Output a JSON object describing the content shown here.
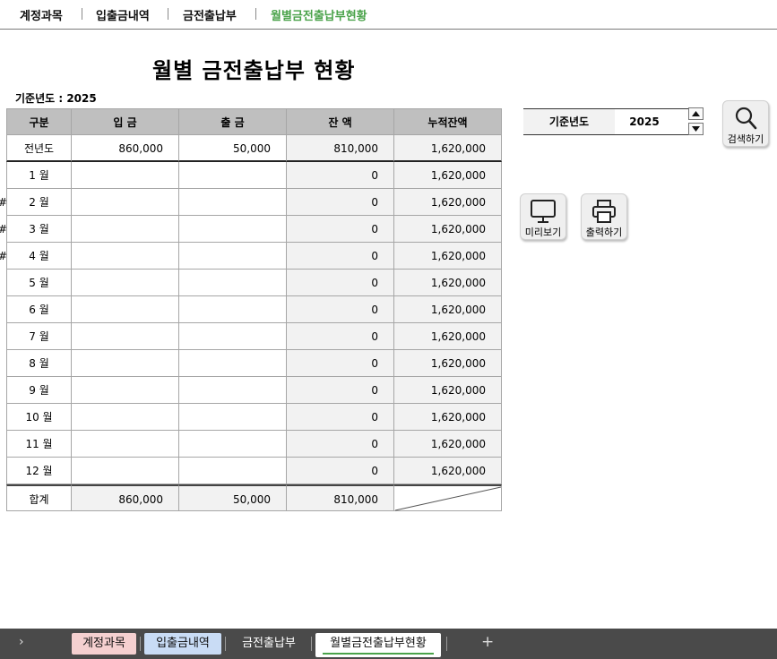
{
  "topnav": {
    "items": [
      {
        "label": "계정과목"
      },
      {
        "label": "입출금내역"
      },
      {
        "label": "금전출납부"
      },
      {
        "label": "월별금전출납부현황"
      }
    ],
    "active_color": "#4aa34a"
  },
  "page": {
    "title": "월별 금전출납부 현황",
    "year_caption": "기준년도 : 2025"
  },
  "table": {
    "headers": [
      "구분",
      "입 금",
      "출 금",
      "잔 액",
      "누적잔액"
    ],
    "prev_year": {
      "label": "전년도",
      "deposit": "860,000",
      "withdraw": "50,000",
      "balance": "810,000",
      "cumulative": "1,620,000"
    },
    "months": [
      {
        "label": "1 월",
        "deposit": "",
        "withdraw": "",
        "balance": "0",
        "cumulative": "1,620,000",
        "mark": ""
      },
      {
        "label": "2 월",
        "deposit": "",
        "withdraw": "",
        "balance": "0",
        "cumulative": "1,620,000",
        "mark": "#"
      },
      {
        "label": "3 월",
        "deposit": "",
        "withdraw": "",
        "balance": "0",
        "cumulative": "1,620,000",
        "mark": "#"
      },
      {
        "label": "4 월",
        "deposit": "",
        "withdraw": "",
        "balance": "0",
        "cumulative": "1,620,000",
        "mark": "#"
      },
      {
        "label": "5 월",
        "deposit": "",
        "withdraw": "",
        "balance": "0",
        "cumulative": "1,620,000",
        "mark": ""
      },
      {
        "label": "6 월",
        "deposit": "",
        "withdraw": "",
        "balance": "0",
        "cumulative": "1,620,000",
        "mark": ""
      },
      {
        "label": "7 월",
        "deposit": "",
        "withdraw": "",
        "balance": "0",
        "cumulative": "1,620,000",
        "mark": ""
      },
      {
        "label": "8 월",
        "deposit": "",
        "withdraw": "",
        "balance": "0",
        "cumulative": "1,620,000",
        "mark": ""
      },
      {
        "label": "9 월",
        "deposit": "",
        "withdraw": "",
        "balance": "0",
        "cumulative": "1,620,000",
        "mark": ""
      },
      {
        "label": "10 월",
        "deposit": "",
        "withdraw": "",
        "balance": "0",
        "cumulative": "1,620,000",
        "mark": ""
      },
      {
        "label": "11 월",
        "deposit": "",
        "withdraw": "",
        "balance": "0",
        "cumulative": "1,620,000",
        "mark": ""
      },
      {
        "label": "12 월",
        "deposit": "",
        "withdraw": "",
        "balance": "0",
        "cumulative": "1,620,000",
        "mark": ""
      }
    ],
    "total": {
      "label": "합계",
      "deposit": "860,000",
      "withdraw": "50,000",
      "balance": "810,000"
    }
  },
  "panel": {
    "year_label": "기준년도",
    "year_value": "2025",
    "search_label": "검색하기",
    "preview_label": "미리보기",
    "print_label": "출력하기",
    "search_icon": "magnifier-icon",
    "preview_icon": "monitor-icon",
    "print_icon": "printer-icon"
  },
  "sheet_tabs": {
    "tabs": [
      {
        "label": "계정과목",
        "bg": "#f5d0d0",
        "color": "#111111"
      },
      {
        "label": "입출금내역",
        "bg": "#c9dcf5",
        "color": "#111111"
      },
      {
        "label": "금전출납부",
        "bg": "",
        "color": "#ffffff"
      },
      {
        "label": "월별금전출납부현황",
        "bg": "#ffffff",
        "color": "#111111"
      }
    ],
    "active_underline": "#4aa34a"
  }
}
